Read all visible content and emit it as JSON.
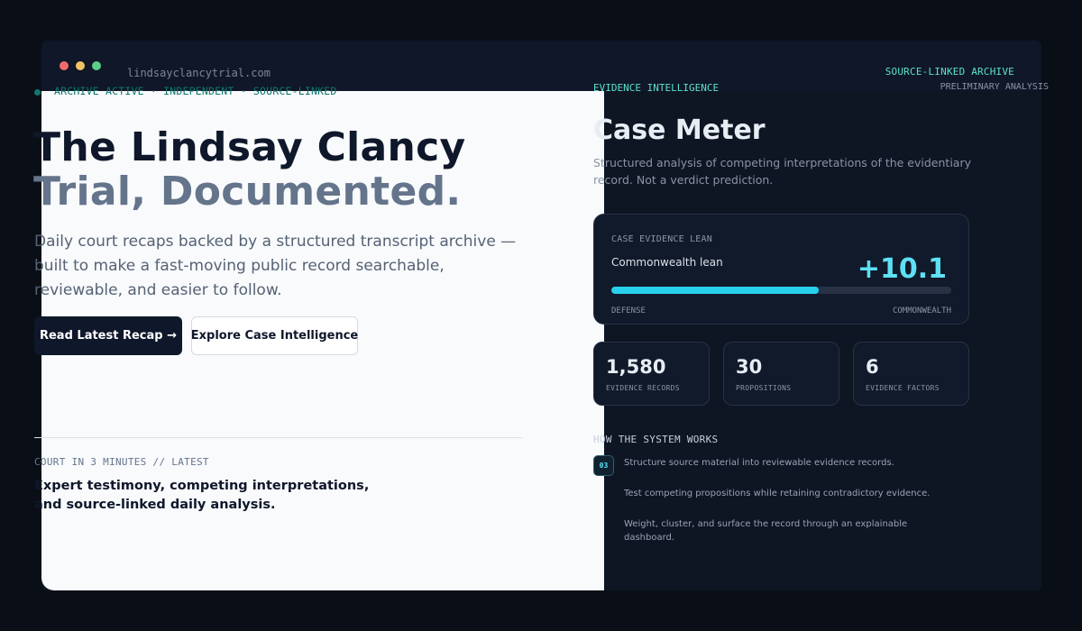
{
  "window": {
    "url": "lindsayclancytrial.com",
    "archive_label": "SOURCE-LINKED ARCHIVE"
  },
  "hero": {
    "status": "ARCHIVE ACTIVE · INDEPENDENT · SOURCE-LINKED",
    "title_line1": "The Lindsay Clancy",
    "title_line2": "Trial, Documented.",
    "description": "Daily court recaps backed by a structured transcript archive — built to make a fast-moving public record searchable, reviewable, and easier to follow.",
    "primary_button": "Read Latest Recap →",
    "secondary_button": "Explore Case Intelligence"
  },
  "latest": {
    "kicker": "COURT IN 3 MINUTES // LATEST",
    "line1": "Expert testimony, competing interpretations,",
    "line2": "and source-linked daily analysis."
  },
  "panel": {
    "label": "EVIDENCE INTELLIGENCE",
    "status": "PRELIMINARY ANALYSIS",
    "title": "Case Meter",
    "description": "Structured analysis of competing interpretations of the evidentiary record. Not a verdict prediction.",
    "lean": {
      "kicker": "CASE EVIDENCE LEAN",
      "name": "Commonwealth lean",
      "value": "+10.1",
      "fill_fraction": 0.61,
      "left_label": "DEFENSE",
      "right_label": "COMMONWEALTH"
    },
    "stats": [
      {
        "value": "1,580",
        "label": "EVIDENCE RECORDS"
      },
      {
        "value": "30",
        "label": "PROPOSITIONS"
      },
      {
        "value": "6",
        "label": "EVIDENCE FACTORS"
      }
    ],
    "how": {
      "title": "HOW THE SYSTEM WORKS",
      "badge": "03",
      "steps": [
        "Structure source material into reviewable evidence records.",
        "Test competing propositions while retaining contradictory evidence.",
        "Weight, cluster, and surface the record through an explainable dashboard."
      ]
    }
  },
  "colors": {
    "accent_teal": "#5ee0cc",
    "accent_cyan": "#27d1ec",
    "dark_navy": "#0f172a"
  }
}
